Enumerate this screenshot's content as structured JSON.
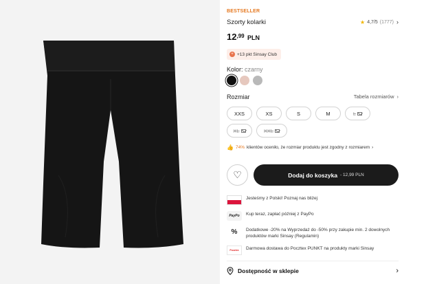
{
  "product": {
    "badge": "BESTSELLER",
    "title": "Szorty kolarki",
    "rating": "4,7/5",
    "rating_count": "(1777)",
    "price_main": "12",
    "price_cents": ",99",
    "currency": "PLN",
    "club_points": "+13 pkt Sinsay Club"
  },
  "color": {
    "label": "Kolor:",
    "value": "czarny",
    "swatches": [
      "#111111",
      "#e6c8be",
      "#b9b9b9"
    ]
  },
  "size": {
    "label": "Rozmiar",
    "table_link": "Tabela rozmiarów",
    "options": [
      "XXS",
      "XS",
      "S",
      "M",
      "L",
      "XL",
      "XXL"
    ]
  },
  "fit": {
    "percent": "74%",
    "text": "klientów oceniło, że rozmiar produktu jest zgodny z rozmiarem"
  },
  "cart": {
    "label": "Dodaj do koszyka",
    "price": "- 12,99 PLN"
  },
  "benefits": [
    "Jesteśmy z Polski! Poznaj nas bliżej",
    "Kup teraz, zapłać później z PayPo",
    "Dodatkowe -20% na Wyprzedaż do -50% przy zakupie min. 2 dowolnych produktów marki Sinsay (Regulamin)",
    "Darmowa dostawa do Pocztex PUNKT na produkty marki Sinsay"
  ],
  "icons": {
    "paypo": "PayPo",
    "percent": "%",
    "pocztex": "Pocztex"
  },
  "availability": {
    "label": "Dostępność w sklepie"
  }
}
